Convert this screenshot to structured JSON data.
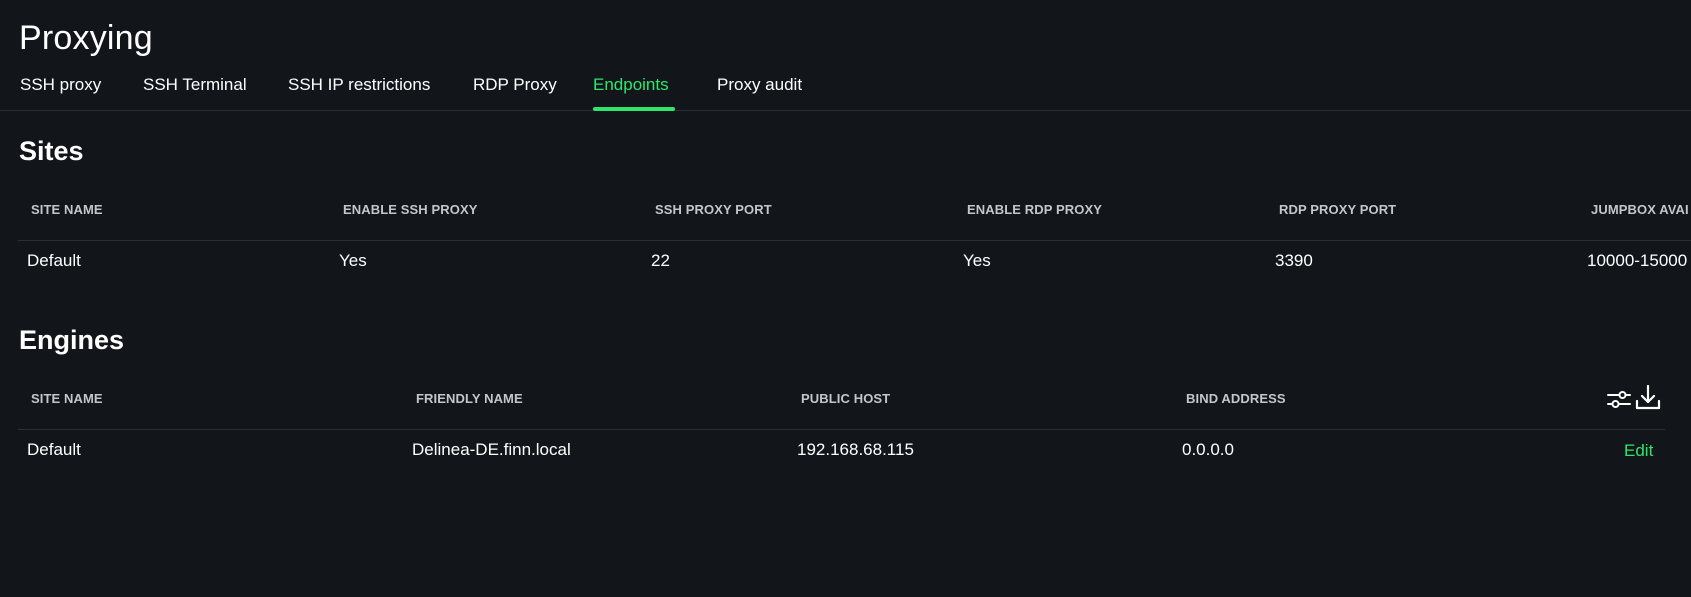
{
  "page": {
    "title": "Proxying"
  },
  "tabs": [
    {
      "label": "SSH proxy",
      "active": false
    },
    {
      "label": "SSH Terminal",
      "active": false
    },
    {
      "label": "SSH IP restrictions",
      "active": false
    },
    {
      "label": "RDP Proxy",
      "active": false
    },
    {
      "label": "Endpoints",
      "active": true
    },
    {
      "label": "Proxy audit",
      "active": false
    }
  ],
  "sites": {
    "title": "Sites",
    "columns": [
      "SITE NAME",
      "ENABLE SSH PROXY",
      "SSH PROXY PORT",
      "ENABLE RDP PROXY",
      "RDP PROXY PORT",
      "JUMPBOX AVAI"
    ],
    "rows": [
      [
        "Default",
        "Yes",
        "22",
        "Yes",
        "3390",
        "10000-15000"
      ]
    ]
  },
  "engines": {
    "title": "Engines",
    "columns": [
      "SITE NAME",
      "FRIENDLY NAME",
      "PUBLIC HOST",
      "BIND ADDRESS"
    ],
    "rows": [
      [
        "Default",
        "Delinea-DE.finn.local",
        "192.168.68.115",
        "0.0.0.0"
      ]
    ],
    "row_action_label": "Edit",
    "toolbar_icons": [
      "filter-sliders-icon",
      "download-icon"
    ]
  },
  "colors": {
    "background": "#12161a",
    "accent": "#2ee66b",
    "text": "#ffffff",
    "header_text": "#c3c7cc",
    "divider": "#2a2f35"
  }
}
